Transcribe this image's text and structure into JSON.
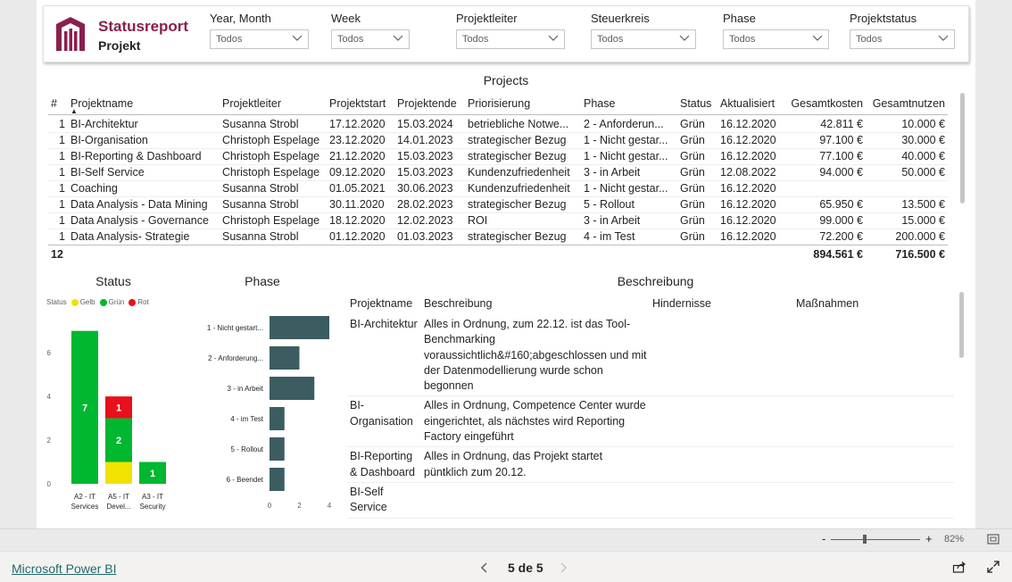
{
  "header": {
    "title": "Statusreport",
    "subtitle": "Projekt",
    "slicers": [
      {
        "label": "Year, Month",
        "value": "Todos"
      },
      {
        "label": "Week",
        "value": "Todos"
      },
      {
        "label": "Projektleiter",
        "value": "Todos"
      },
      {
        "label": "Steuerkreis",
        "value": "Todos"
      },
      {
        "label": "Phase",
        "value": "Todos"
      },
      {
        "label": "Projektstatus",
        "value": "Todos"
      }
    ]
  },
  "projects": {
    "title": "Projects",
    "columns": [
      "#",
      "Projektname",
      "Projektleiter",
      "Projektstart",
      "Projektende",
      "Priorisierung",
      "Phase",
      "Status",
      "Aktualisiert",
      "Gesamtkosten",
      "Gesamtnutzen"
    ],
    "rows": [
      [
        "1",
        "BI-Architektur",
        "Susanna Strobl",
        "17.12.2020",
        "15.03.2024",
        "betriebliche Notwe...",
        "2 - Anforderun...",
        "Grün",
        "16.12.2020",
        "42.811 €",
        "10.000 €"
      ],
      [
        "1",
        "BI-Organisation",
        "Christoph Espelage",
        "23.12.2020",
        "14.01.2023",
        "strategischer Bezug",
        "1 - Nicht gestar...",
        "Grün",
        "16.12.2020",
        "97.100 €",
        "30.000 €"
      ],
      [
        "1",
        "BI-Reporting & Dashboard",
        "Christoph Espelage",
        "21.12.2020",
        "15.03.2023",
        "strategischer Bezug",
        "1 - Nicht gestar...",
        "Grün",
        "16.12.2020",
        "77.100 €",
        "40.000 €"
      ],
      [
        "1",
        "BI-Self Service",
        "Christoph Espelage",
        "09.12.2020",
        "15.03.2023",
        "Kundenzufriedenheit",
        "3 - in Arbeit",
        "Grün",
        "12.08.2022",
        "94.000 €",
        "50.000 €"
      ],
      [
        "1",
        "Coaching",
        "Susanna Strobl",
        "01.05.2021",
        "30.06.2023",
        "Kundenzufriedenheit",
        "1 - Nicht gestar...",
        "Grün",
        "16.12.2020",
        "",
        ""
      ],
      [
        "1",
        "Data Analysis - Data Mining",
        "Susanna Strobl",
        "30.11.2020",
        "28.02.2023",
        "strategischer Bezug",
        "5 - Rollout",
        "Grün",
        "16.12.2020",
        "65.950 €",
        "13.500 €"
      ],
      [
        "1",
        "Data Analysis - Governance",
        "Christoph Espelage",
        "18.12.2020",
        "12.02.2023",
        "ROI",
        "3 - in Arbeit",
        "Grün",
        "16.12.2020",
        "99.000 €",
        "15.000 €"
      ],
      [
        "1",
        "Data Analysis- Strategie",
        "Susanna Strobl",
        "01.12.2020",
        "01.03.2023",
        "strategischer Bezug",
        "4 - im Test",
        "Grün",
        "16.12.2020",
        "72.200 €",
        "200.000 €"
      ]
    ],
    "total": {
      "count": "12",
      "kosten": "894.561 €",
      "nutzen": "716.500 €"
    }
  },
  "status_chart": {
    "title": "Status",
    "legend_title": "Status",
    "legend": [
      {
        "name": "Gelb",
        "color": "#f2e200"
      },
      {
        "name": "Grün",
        "color": "#00b730"
      },
      {
        "name": "Rot",
        "color": "#e8101a"
      }
    ]
  },
  "phase_chart": {
    "title": "Phase"
  },
  "chart_data": [
    {
      "type": "bar",
      "title": "Status",
      "stacked": true,
      "categories": [
        "A2 - IT Services",
        "A5 - IT Devel...",
        "A3 - IT Security"
      ],
      "category_lines": [
        [
          "A2 - IT",
          "Services"
        ],
        [
          "A5 - IT",
          "Devel..."
        ],
        [
          "A3 - IT",
          "Security"
        ]
      ],
      "series": [
        {
          "name": "Gelb",
          "values": [
            0,
            1,
            0
          ],
          "color": "#f2e200"
        },
        {
          "name": "Grün",
          "values": [
            7,
            2,
            1
          ],
          "color": "#00b730"
        },
        {
          "name": "Rot",
          "values": [
            0,
            1,
            0
          ],
          "color": "#e8101a"
        }
      ],
      "labels": [
        [
          null,
          "",
          null
        ],
        [
          "7",
          "2",
          "1"
        ],
        [
          null,
          "1",
          null
        ]
      ],
      "yticks": [
        0,
        2,
        4,
        6
      ],
      "ylim": [
        0,
        7.6
      ],
      "legend": "top-left"
    },
    {
      "type": "bar",
      "orientation": "horizontal",
      "title": "Phase",
      "categories": [
        "1 - Nicht gestart...",
        "2 - Anforderung...",
        "3 - in Arbeit",
        "4 - im Test",
        "5 - Rollout",
        "6 - Beendet"
      ],
      "values": [
        4,
        2,
        3,
        1,
        1,
        1
      ],
      "color": "#3b5c61",
      "xticks": [
        0,
        2,
        4
      ],
      "xlim": [
        0,
        4
      ]
    }
  ],
  "description": {
    "title": "Beschreibung",
    "columns": [
      "Projektname",
      "Beschreibung",
      "Hindernisse",
      "Maßnahmen"
    ],
    "rows": [
      {
        "name": "BI-Architektur",
        "text": "Alles in Ordnung, zum 22.12. ist das Tool-Benchmarking voraussichtlich&#160;abgeschlossen und mit der Datenmodellierung wurde schon begonnen",
        "hindernisse": "",
        "massnahmen": ""
      },
      {
        "name": "BI-Organisation",
        "text": "Alles in Ordnung, Competence Center wurde eingerichtet, als nächstes wird Reporting Factory eingeführt",
        "hindernisse": "",
        "massnahmen": ""
      },
      {
        "name": "BI-Reporting & Dashboard",
        "text": "Alles in Ordnung, das Projekt startet püntklich zum 20.12.",
        "hindernisse": "",
        "massnahmen": ""
      },
      {
        "name": "BI-Self Service",
        "text": "",
        "hindernisse": "",
        "massnahmen": ""
      }
    ]
  },
  "zoom": {
    "value": "82%",
    "minus": "-",
    "plus": "+"
  },
  "footer": {
    "brand": "Microsoft Power BI",
    "page": "5 de 5"
  },
  "colors": {
    "accent": "#8a1f4e",
    "phase_bar": "#3b5c61",
    "link": "#1f6b6a"
  }
}
